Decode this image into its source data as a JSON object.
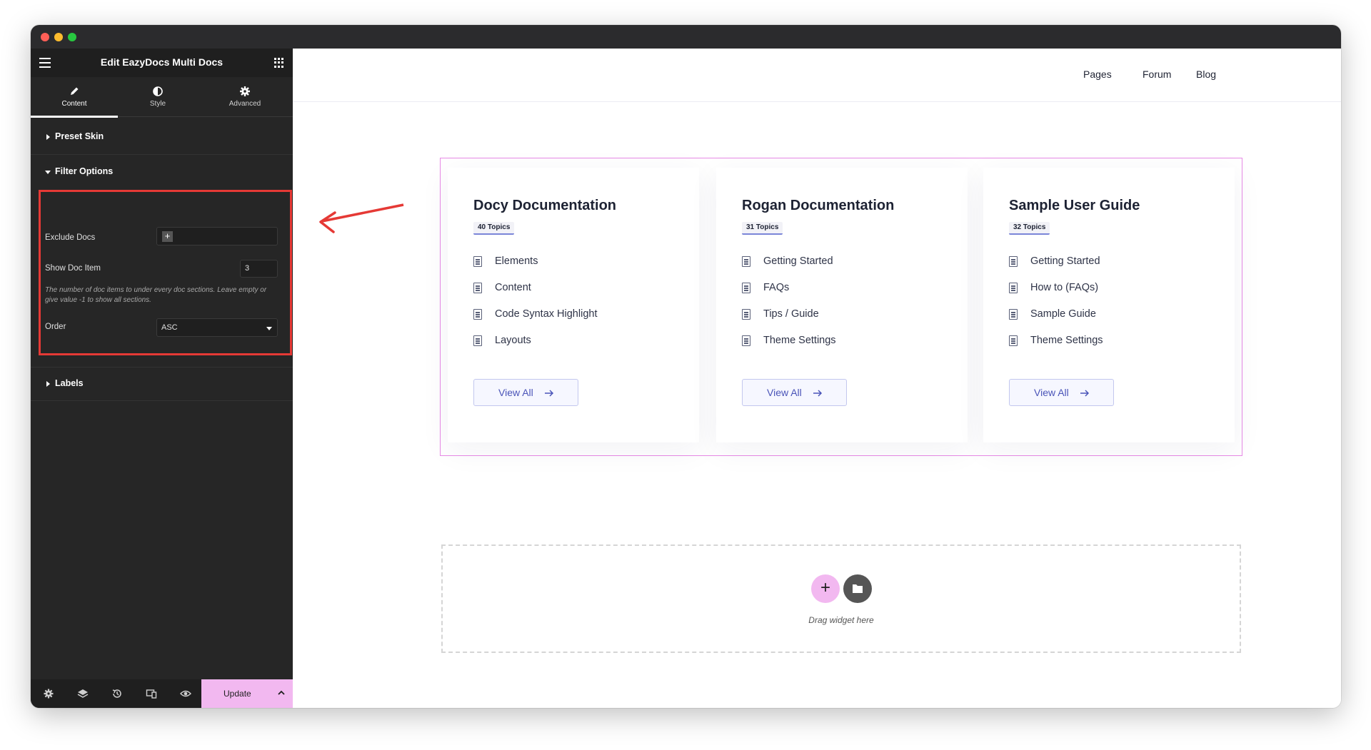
{
  "window": {
    "title_dots": [
      "close",
      "minimize",
      "zoom"
    ]
  },
  "editor": {
    "title": "Edit EazyDocs Multi Docs",
    "tabs": [
      {
        "label": "Content",
        "icon": "pencil-icon",
        "active": true
      },
      {
        "label": "Style",
        "icon": "half-circle-icon",
        "active": false
      },
      {
        "label": "Advanced",
        "icon": "gear-icon",
        "active": false
      }
    ],
    "sections": {
      "preset_skin": "Preset Skin",
      "filter_options": "Filter Options",
      "labels": "Labels"
    },
    "filter": {
      "exclude_docs_label": "Exclude Docs",
      "show_doc_item_label": "Show Doc Item",
      "show_doc_item_value": "3",
      "help_text": "The number of doc items to under every doc sections. Leave empty or give value -1 to show all sections.",
      "order_label": "Order",
      "order_value": "ASC"
    },
    "footer": {
      "icons": [
        "settings-icon",
        "layers-icon",
        "history-icon",
        "responsive-icon",
        "preview-eye-icon"
      ],
      "update_label": "Update"
    },
    "highlight_color": "#e53935"
  },
  "preview": {
    "nav": [
      "Pages",
      "Forum",
      "Blog"
    ],
    "cards": [
      {
        "title": "Docy Documentation",
        "topics": "40 Topics",
        "items": [
          "Elements",
          "Content",
          "Code Syntax Highlight",
          "Layouts"
        ],
        "button": "View All"
      },
      {
        "title": "Rogan Documentation",
        "topics": "31 Topics",
        "items": [
          "Getting Started",
          "FAQs",
          "Tips / Guide",
          "Theme Settings"
        ],
        "button": "View All"
      },
      {
        "title": "Sample User Guide",
        "topics": "32 Topics",
        "items": [
          "Getting Started",
          "How to (FAQs)",
          "Sample Guide",
          "Theme Settings"
        ],
        "button": "View All"
      }
    ],
    "drop_zone": {
      "text": "Drag widget here"
    },
    "accent_color": "#e78ae6"
  }
}
